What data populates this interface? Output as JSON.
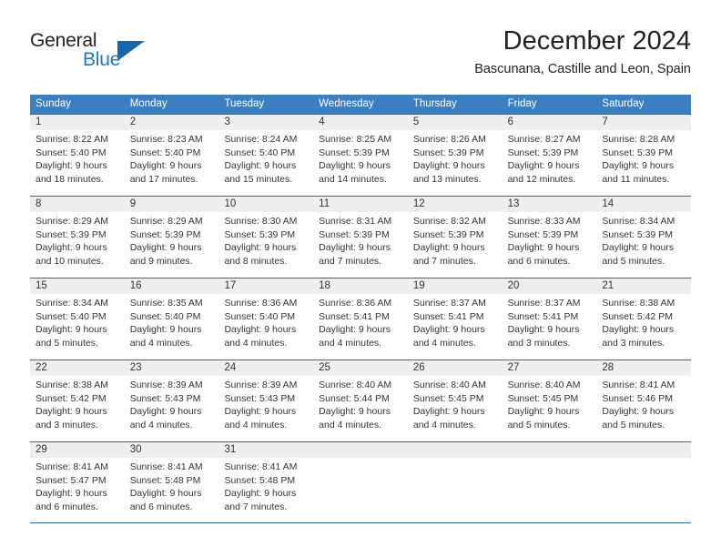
{
  "brand": {
    "name_part1": "General",
    "name_part2": "Blue",
    "logo_icon": "triangle-logo-icon"
  },
  "header": {
    "title": "December 2024",
    "subtitle": "Bascunana, Castille and Leon, Spain"
  },
  "calendar": {
    "weekdays": [
      "Sunday",
      "Monday",
      "Tuesday",
      "Wednesday",
      "Thursday",
      "Friday",
      "Saturday"
    ],
    "accent_color": "#3a7fc1",
    "row_border_color": "#2e6da4",
    "day_band_color": "#eeeeee",
    "weeks": [
      [
        {
          "day": "1",
          "lines": [
            "Sunrise: 8:22 AM",
            "Sunset: 5:40 PM",
            "Daylight: 9 hours",
            "and 18 minutes."
          ]
        },
        {
          "day": "2",
          "lines": [
            "Sunrise: 8:23 AM",
            "Sunset: 5:40 PM",
            "Daylight: 9 hours",
            "and 17 minutes."
          ]
        },
        {
          "day": "3",
          "lines": [
            "Sunrise: 8:24 AM",
            "Sunset: 5:40 PM",
            "Daylight: 9 hours",
            "and 15 minutes."
          ]
        },
        {
          "day": "4",
          "lines": [
            "Sunrise: 8:25 AM",
            "Sunset: 5:39 PM",
            "Daylight: 9 hours",
            "and 14 minutes."
          ]
        },
        {
          "day": "5",
          "lines": [
            "Sunrise: 8:26 AM",
            "Sunset: 5:39 PM",
            "Daylight: 9 hours",
            "and 13 minutes."
          ]
        },
        {
          "day": "6",
          "lines": [
            "Sunrise: 8:27 AM",
            "Sunset: 5:39 PM",
            "Daylight: 9 hours",
            "and 12 minutes."
          ]
        },
        {
          "day": "7",
          "lines": [
            "Sunrise: 8:28 AM",
            "Sunset: 5:39 PM",
            "Daylight: 9 hours",
            "and 11 minutes."
          ]
        }
      ],
      [
        {
          "day": "8",
          "lines": [
            "Sunrise: 8:29 AM",
            "Sunset: 5:39 PM",
            "Daylight: 9 hours",
            "and 10 minutes."
          ]
        },
        {
          "day": "9",
          "lines": [
            "Sunrise: 8:29 AM",
            "Sunset: 5:39 PM",
            "Daylight: 9 hours",
            "and 9 minutes."
          ]
        },
        {
          "day": "10",
          "lines": [
            "Sunrise: 8:30 AM",
            "Sunset: 5:39 PM",
            "Daylight: 9 hours",
            "and 8 minutes."
          ]
        },
        {
          "day": "11",
          "lines": [
            "Sunrise: 8:31 AM",
            "Sunset: 5:39 PM",
            "Daylight: 9 hours",
            "and 7 minutes."
          ]
        },
        {
          "day": "12",
          "lines": [
            "Sunrise: 8:32 AM",
            "Sunset: 5:39 PM",
            "Daylight: 9 hours",
            "and 7 minutes."
          ]
        },
        {
          "day": "13",
          "lines": [
            "Sunrise: 8:33 AM",
            "Sunset: 5:39 PM",
            "Daylight: 9 hours",
            "and 6 minutes."
          ]
        },
        {
          "day": "14",
          "lines": [
            "Sunrise: 8:34 AM",
            "Sunset: 5:39 PM",
            "Daylight: 9 hours",
            "and 5 minutes."
          ]
        }
      ],
      [
        {
          "day": "15",
          "lines": [
            "Sunrise: 8:34 AM",
            "Sunset: 5:40 PM",
            "Daylight: 9 hours",
            "and 5 minutes."
          ]
        },
        {
          "day": "16",
          "lines": [
            "Sunrise: 8:35 AM",
            "Sunset: 5:40 PM",
            "Daylight: 9 hours",
            "and 4 minutes."
          ]
        },
        {
          "day": "17",
          "lines": [
            "Sunrise: 8:36 AM",
            "Sunset: 5:40 PM",
            "Daylight: 9 hours",
            "and 4 minutes."
          ]
        },
        {
          "day": "18",
          "lines": [
            "Sunrise: 8:36 AM",
            "Sunset: 5:41 PM",
            "Daylight: 9 hours",
            "and 4 minutes."
          ]
        },
        {
          "day": "19",
          "lines": [
            "Sunrise: 8:37 AM",
            "Sunset: 5:41 PM",
            "Daylight: 9 hours",
            "and 4 minutes."
          ]
        },
        {
          "day": "20",
          "lines": [
            "Sunrise: 8:37 AM",
            "Sunset: 5:41 PM",
            "Daylight: 9 hours",
            "and 3 minutes."
          ]
        },
        {
          "day": "21",
          "lines": [
            "Sunrise: 8:38 AM",
            "Sunset: 5:42 PM",
            "Daylight: 9 hours",
            "and 3 minutes."
          ]
        }
      ],
      [
        {
          "day": "22",
          "lines": [
            "Sunrise: 8:38 AM",
            "Sunset: 5:42 PM",
            "Daylight: 9 hours",
            "and 3 minutes."
          ]
        },
        {
          "day": "23",
          "lines": [
            "Sunrise: 8:39 AM",
            "Sunset: 5:43 PM",
            "Daylight: 9 hours",
            "and 4 minutes."
          ]
        },
        {
          "day": "24",
          "lines": [
            "Sunrise: 8:39 AM",
            "Sunset: 5:43 PM",
            "Daylight: 9 hours",
            "and 4 minutes."
          ]
        },
        {
          "day": "25",
          "lines": [
            "Sunrise: 8:40 AM",
            "Sunset: 5:44 PM",
            "Daylight: 9 hours",
            "and 4 minutes."
          ]
        },
        {
          "day": "26",
          "lines": [
            "Sunrise: 8:40 AM",
            "Sunset: 5:45 PM",
            "Daylight: 9 hours",
            "and 4 minutes."
          ]
        },
        {
          "day": "27",
          "lines": [
            "Sunrise: 8:40 AM",
            "Sunset: 5:45 PM",
            "Daylight: 9 hours",
            "and 5 minutes."
          ]
        },
        {
          "day": "28",
          "lines": [
            "Sunrise: 8:41 AM",
            "Sunset: 5:46 PM",
            "Daylight: 9 hours",
            "and 5 minutes."
          ]
        }
      ],
      [
        {
          "day": "29",
          "lines": [
            "Sunrise: 8:41 AM",
            "Sunset: 5:47 PM",
            "Daylight: 9 hours",
            "and 6 minutes."
          ]
        },
        {
          "day": "30",
          "lines": [
            "Sunrise: 8:41 AM",
            "Sunset: 5:48 PM",
            "Daylight: 9 hours",
            "and 6 minutes."
          ]
        },
        {
          "day": "31",
          "lines": [
            "Sunrise: 8:41 AM",
            "Sunset: 5:48 PM",
            "Daylight: 9 hours",
            "and 7 minutes."
          ]
        },
        {
          "day": "",
          "lines": []
        },
        {
          "day": "",
          "lines": []
        },
        {
          "day": "",
          "lines": []
        },
        {
          "day": "",
          "lines": []
        }
      ]
    ]
  }
}
